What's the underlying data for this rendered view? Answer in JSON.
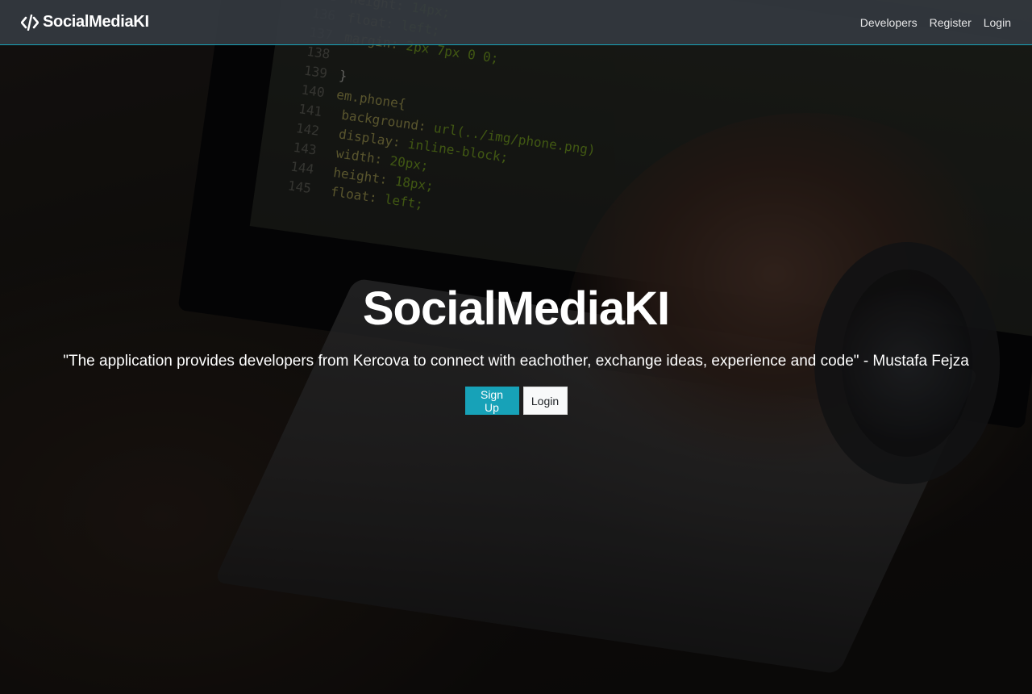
{
  "colors": {
    "navbar_bg": "#343a40",
    "accent": "#17a2b8",
    "light_button": "#f8f9fa"
  },
  "navbar": {
    "brand_icon": "code-icon",
    "brand": "SocialMediaKI",
    "links": [
      {
        "label": "Developers"
      },
      {
        "label": "Register"
      },
      {
        "label": "Login"
      }
    ]
  },
  "hero": {
    "title": "SocialMediaKI",
    "quote": "\"The application provides developers from Kercova to connect with eachother, exchange ideas, experience and code\" - Mustafa Fejza",
    "signup_label": "Sign Up",
    "login_label": "Login"
  }
}
